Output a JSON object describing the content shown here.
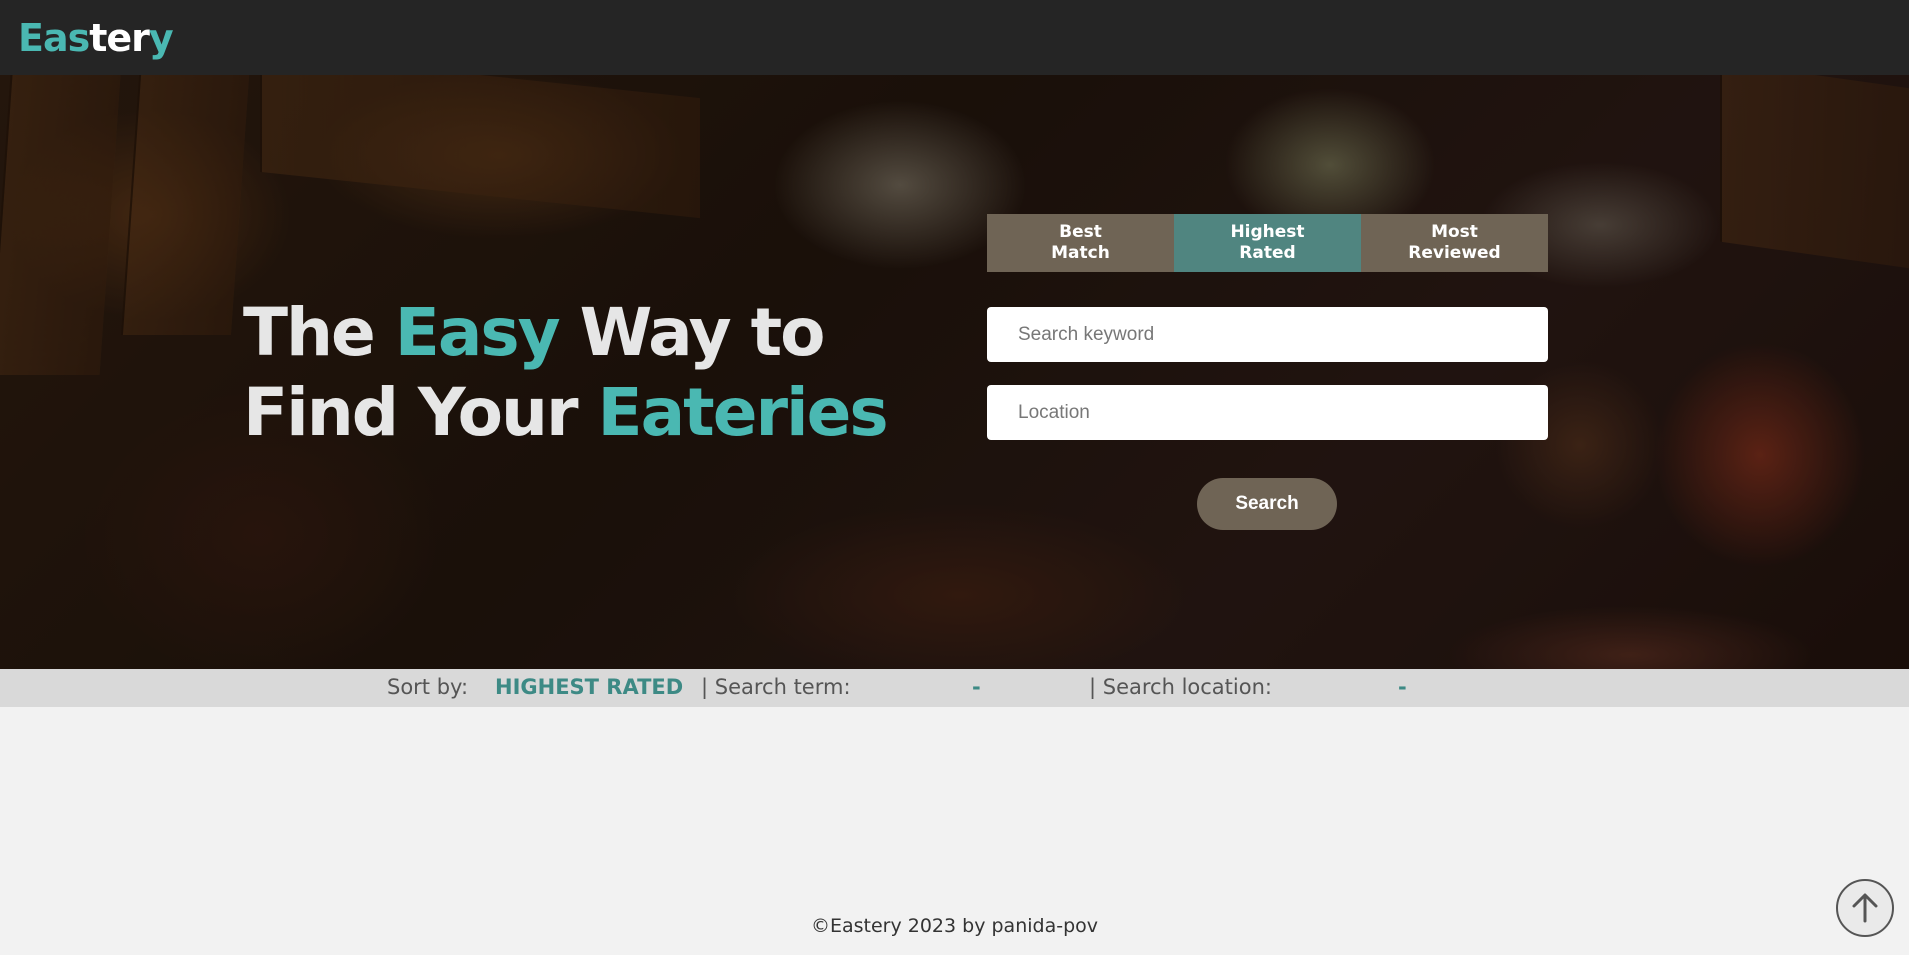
{
  "navbar": {
    "logo_part1": "Eas",
    "logo_part2": "ter",
    "logo_part3": "y"
  },
  "hero": {
    "headline": {
      "word1": "The ",
      "word2": "Easy",
      "word3": " Way to",
      "word4": "Find Your ",
      "word5": "Eateries"
    },
    "sort_tabs": [
      {
        "label_line1": "Best",
        "label_line2": "Match",
        "active": false
      },
      {
        "label_line1": "Highest",
        "label_line2": "Rated",
        "active": true
      },
      {
        "label_line1": "Most",
        "label_line2": "Reviewed",
        "active": false
      }
    ],
    "keyword_placeholder": "Search keyword",
    "keyword_value": "",
    "location_placeholder": "Location",
    "location_value": "",
    "search_label": "Search"
  },
  "status": {
    "sort_label": "Sort by:",
    "sort_value": "HIGHEST RATED",
    "term_label": "| Search term:",
    "term_value": "-",
    "location_label": "| Search location:",
    "location_value": "-"
  },
  "footer": {
    "copyright_symbol": "©",
    "text": "Eastery 2023 by panida-pov"
  },
  "icons": {
    "scroll_top": "arrow-up-circle-icon"
  },
  "colors": {
    "accent": "#4ab8b2",
    "nav_bg": "#252525",
    "tab_bg": "#6f6455",
    "tab_active_bg": "#508580",
    "status_value": "#3d8a85"
  }
}
